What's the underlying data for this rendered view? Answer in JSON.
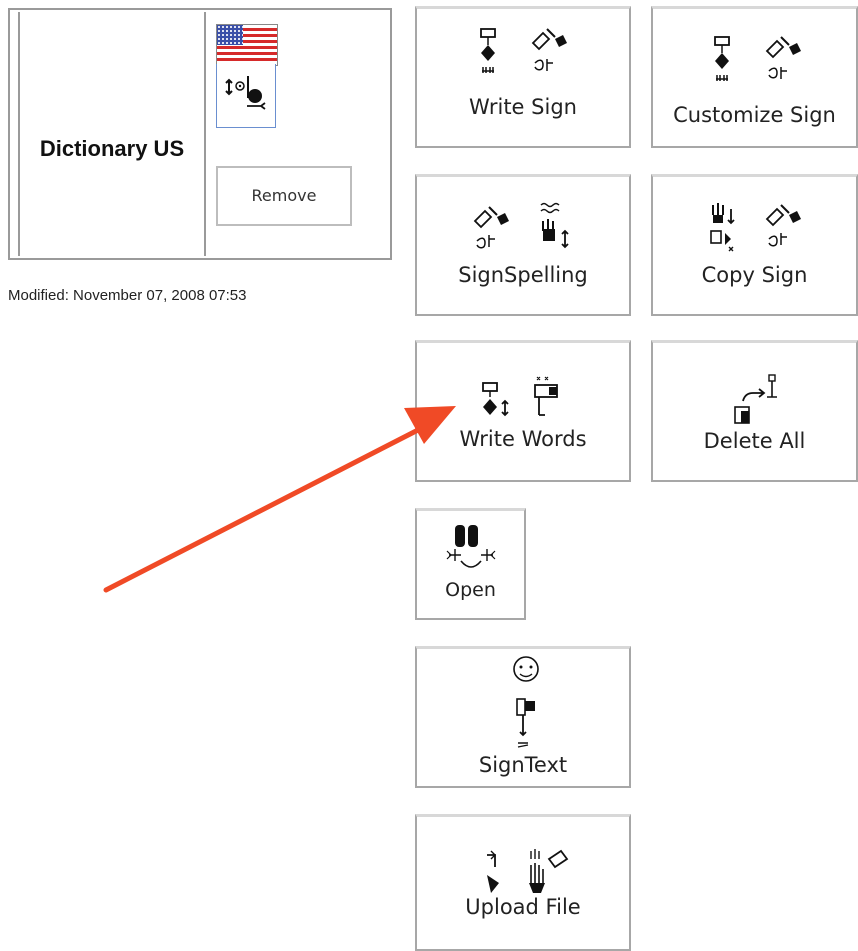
{
  "dictionary": {
    "title": "Dictionary US",
    "remove_label": "Remove",
    "modified": "Modified: November 07, 2008 07:53"
  },
  "tiles": {
    "write_sign": "Write Sign",
    "customize_sign": "Customize Sign",
    "signspelling": "SignSpelling",
    "copy_sign": "Copy Sign",
    "write_words": "Write Words",
    "delete_all": "Delete All",
    "open": "Open",
    "signtext": "SignText",
    "upload_file": "Upload File"
  },
  "colors": {
    "annotation_arrow": "#f04a26",
    "tile_border": "#a7a7a7",
    "flag_red": "#d62a2a",
    "flag_blue": "#3a4fa8"
  }
}
